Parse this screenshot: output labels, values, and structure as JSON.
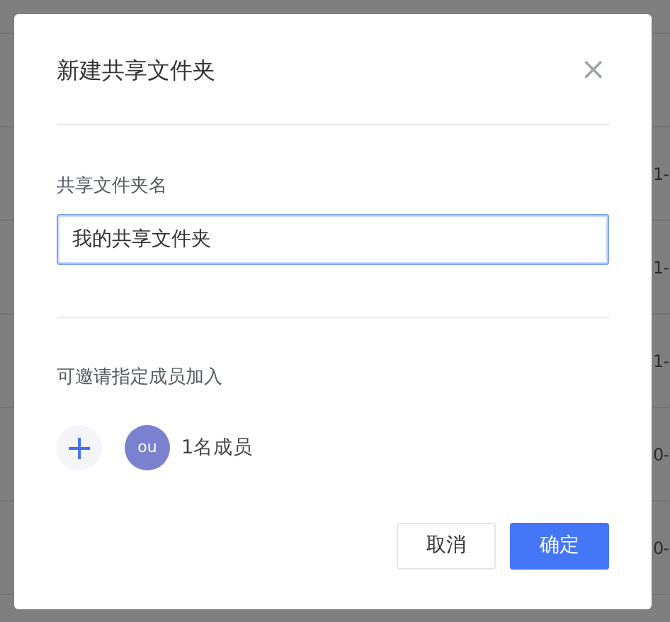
{
  "background": {
    "rows": [
      {
        "cell": ""
      },
      {
        "cell": ""
      },
      {
        "cell": "1-"
      },
      {
        "cell": "1-"
      },
      {
        "cell": "1-"
      },
      {
        "cell": "0-"
      },
      {
        "cell": "0-"
      }
    ]
  },
  "dialog": {
    "title": "新建共享文件夹",
    "close": "×",
    "name_label": "共享文件夹名",
    "name_field": {
      "value": "我的共享文件夹",
      "focused": true
    },
    "invite_label": "可邀请指定成员加入",
    "add": "+",
    "members": [
      {
        "initials": "ou",
        "color": "#7b80cf"
      }
    ],
    "member_count": "1名成员",
    "buttons": [
      {
        "label": "取消",
        "kind": "secondary"
      },
      {
        "label": "确定",
        "kind": "primary"
      }
    ]
  }
}
